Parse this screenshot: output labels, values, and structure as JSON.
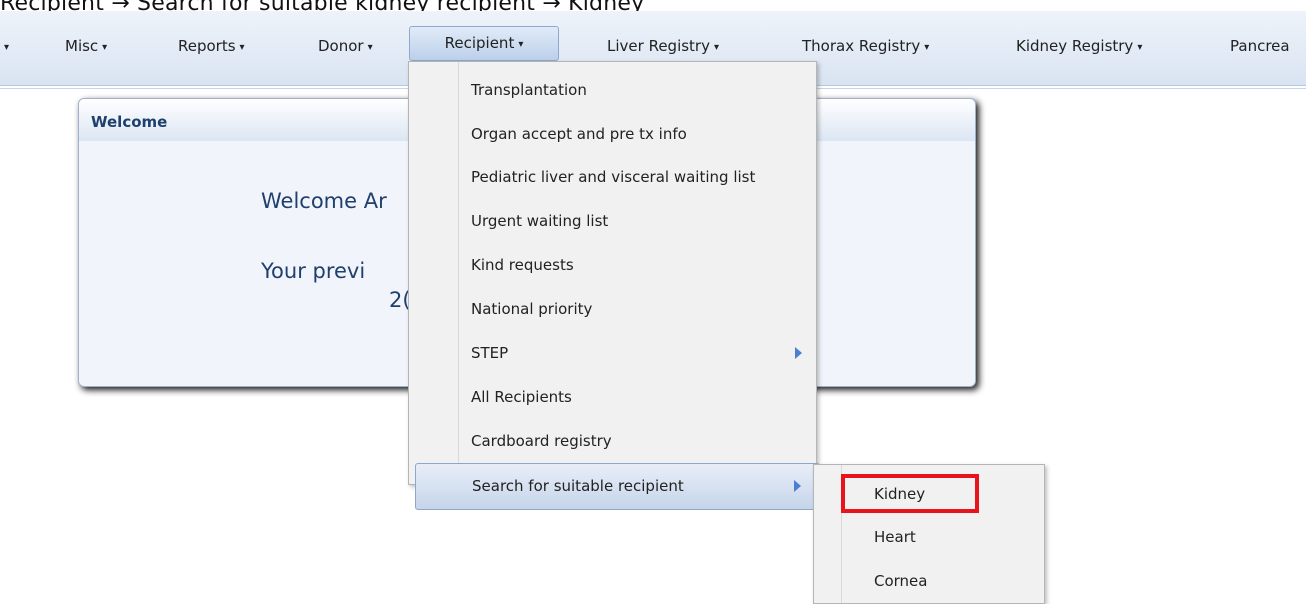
{
  "caption": "Recipient → Search for suitable kidney recipient → Kidney",
  "nav": {
    "items": [
      {
        "label": "Misc"
      },
      {
        "label": "Reports"
      },
      {
        "label": "Donor"
      },
      {
        "label": "Recipient"
      },
      {
        "label": "Liver Registry"
      },
      {
        "label": "Thorax Registry"
      },
      {
        "label": "Kidney Registry"
      },
      {
        "label": "Pancrea"
      }
    ],
    "active_index": 3
  },
  "welcome_panel": {
    "title": "Welcome",
    "line1": "Welcome Ar",
    "line2": "Your previ",
    "line3": "2("
  },
  "recipient_menu": {
    "items": [
      {
        "label": "Transplantation"
      },
      {
        "label": "Organ accept and pre tx info"
      },
      {
        "label": "Pediatric liver and visceral waiting list"
      },
      {
        "label": "Urgent waiting list"
      },
      {
        "label": "Kind requests"
      },
      {
        "label": "National priority"
      },
      {
        "label": "STEP",
        "icon": "submenu-arrow-icon"
      },
      {
        "label": "All Recipients"
      },
      {
        "label": "Cardboard registry"
      },
      {
        "label": "Search for suitable recipient",
        "icon": "submenu-arrow-icon"
      }
    ]
  },
  "search_submenu": {
    "items": [
      {
        "label": "Kidney"
      },
      {
        "label": "Heart"
      },
      {
        "label": "Cornea"
      }
    ]
  },
  "colors": {
    "highlight": "#e8141b",
    "title_text": "#1f3f6d",
    "arrow": "#4a7fd1"
  }
}
